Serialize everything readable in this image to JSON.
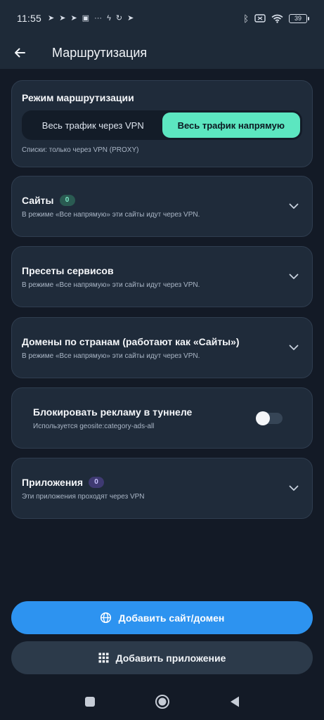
{
  "status_bar": {
    "time": "11:55",
    "battery": "39"
  },
  "app_bar": {
    "title": "Маршрутизация"
  },
  "routing_mode": {
    "title": "Режим маршрутизации",
    "options": [
      "Весь трафик через VPN",
      "Весь трафик напрямую"
    ],
    "selected_index": 1,
    "note": "Списки: только через VPN (PROXY)"
  },
  "sections": [
    {
      "title": "Сайты",
      "badge": "0",
      "subtitle": "В режиме «Все напрямую» эти сайты идут через VPN."
    },
    {
      "title": "Пресеты сервисов",
      "subtitle": "В режиме «Все напрямую» эти сайты идут через VPN."
    },
    {
      "title": "Домены по странам (работают как «Сайты»)",
      "subtitle": "В режиме «Все напрямую» эти сайты идут через VPN."
    }
  ],
  "ad_block": {
    "title": "Блокировать рекламу в туннеле",
    "subtitle": "Используется geosite:category-ads-all",
    "enabled": false
  },
  "apps": {
    "title": "Приложения",
    "badge": "0",
    "subtitle": "Эти приложения проходят через VPN"
  },
  "buttons": {
    "add_site": "Добавить сайт/домен",
    "add_app": "Добавить приложение"
  },
  "colors": {
    "background": "#131a26",
    "card": "#1f2b3a",
    "accent_mint": "#5ce6c0",
    "primary_blue": "#2d93f0",
    "badge_green": "#2a5b52",
    "badge_purple": "#3f3a72"
  },
  "icons": {
    "back": "arrow-left-icon",
    "chevron": "chevron-down-icon",
    "globe": "globe-icon",
    "grid": "grid-icon",
    "nav_recents": "square-icon",
    "nav_home": "circle-icon",
    "nav_back": "triangle-icon"
  }
}
